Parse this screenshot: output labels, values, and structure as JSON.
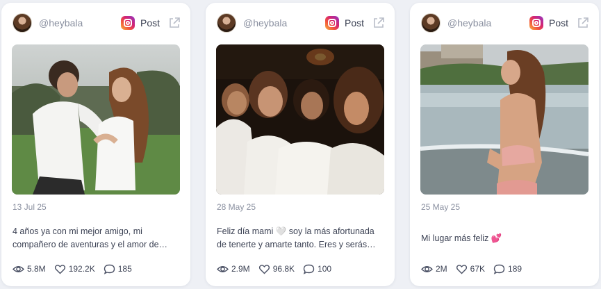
{
  "posts": [
    {
      "handle": "@heybala",
      "type_label": "Post",
      "date": "13 Jul 25",
      "caption": "4 años ya con mi mejor amigo, mi\ncompañero de aventuras y el amor de…",
      "views": "5.8M",
      "likes": "192.2K",
      "comments": "185",
      "photo_alt": "Couple embracing outdoors"
    },
    {
      "handle": "@heybala",
      "type_label": "Post",
      "date": "28 May 25",
      "caption": "Feliz día mami 🤍 soy la más afortunada\nde tenerte y amarte tanto. Eres y serás…",
      "views": "2.9M",
      "likes": "96.8K",
      "comments": "100",
      "photo_alt": "Four women smiling together at night"
    },
    {
      "handle": "@heybala",
      "type_label": "Post",
      "date": "25 May 25",
      "caption": "Mi lugar más feliz 💕",
      "views": "2M",
      "likes": "67K",
      "comments": "189",
      "photo_alt": "Girl in bikini at the beach"
    }
  ],
  "icons": {
    "platform": "instagram-icon",
    "external": "external-link-icon",
    "views": "eye-icon",
    "likes": "heart-icon",
    "comments": "comment-icon"
  },
  "colors": {
    "card_bg": "#ffffff",
    "page_bg": "#eef0f5",
    "muted_text": "#8a90a0",
    "body_text": "#3c4254"
  }
}
